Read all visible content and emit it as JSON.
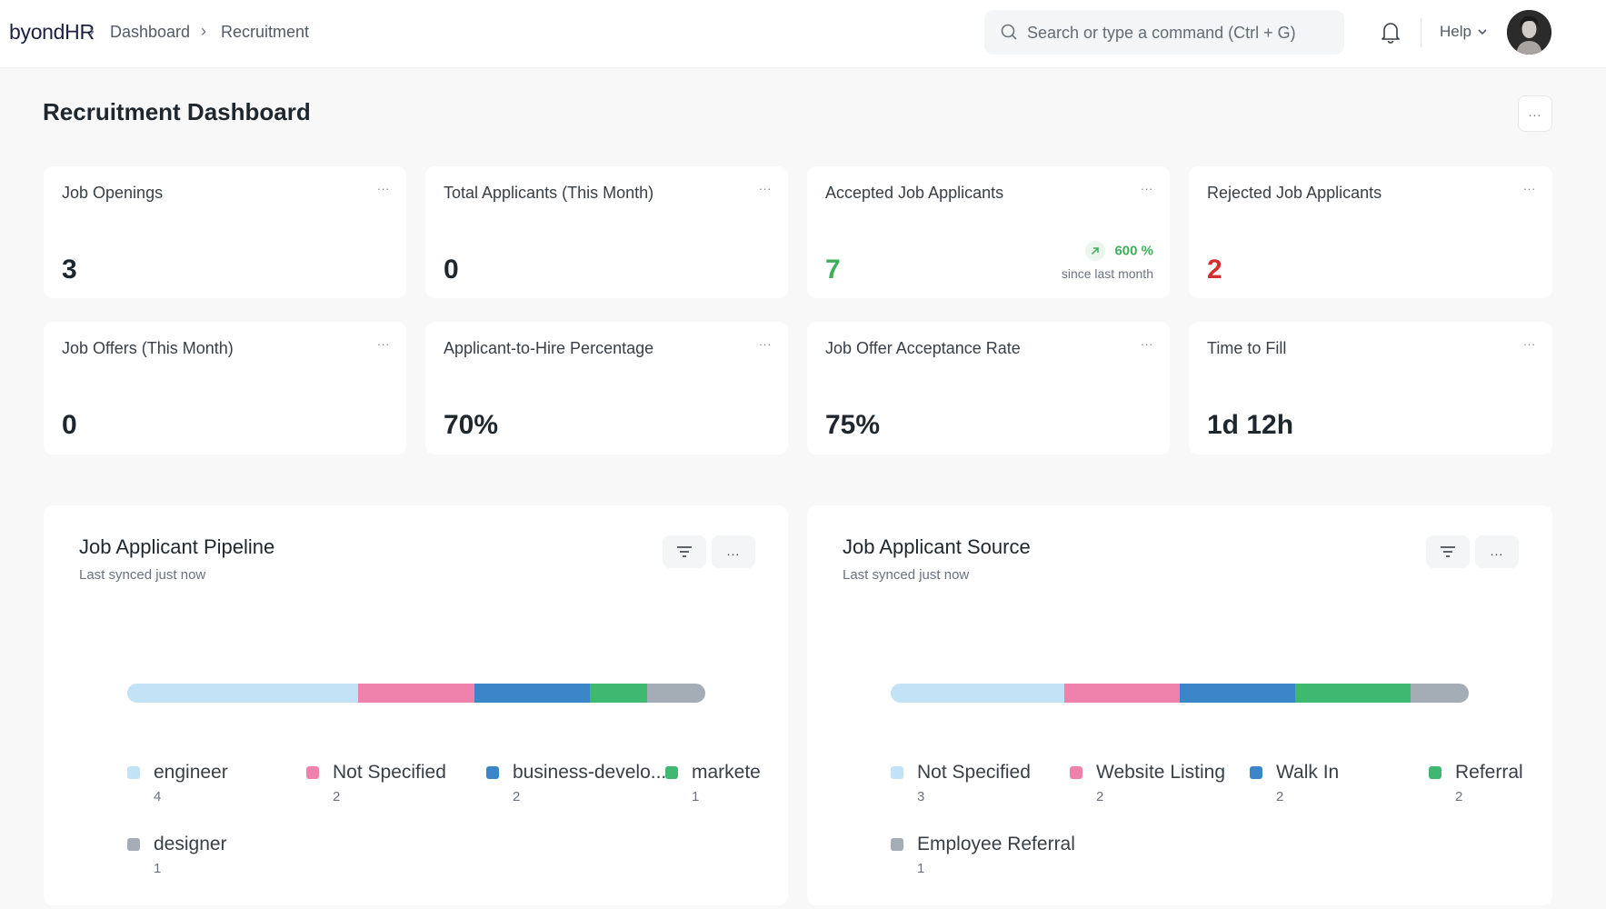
{
  "navbar": {
    "brand": "byondHR",
    "breadcrumbs": [
      "Dashboard",
      "Recruitment"
    ],
    "search_placeholder": "Search or type a command (Ctrl + G)",
    "help_label": "Help",
    "icons": {
      "search": "search-icon",
      "notifications": "bell-icon",
      "help_dropdown": "chevron-down-icon",
      "avatar": "user-avatar"
    }
  },
  "page": {
    "title": "Recruitment Dashboard",
    "menu_label": "..."
  },
  "number_cards": [
    {
      "title": "Job Openings",
      "value": "3",
      "menu": "..."
    },
    {
      "title": "Total Applicants (This Month)",
      "value": "0",
      "menu": "..."
    },
    {
      "title": "Accepted Job Applicants",
      "value": "7",
      "menu": "...",
      "value_color": "#3fae5a",
      "trend": {
        "direction": "up",
        "icon": "arrow-up-right-icon",
        "percent": "600 %",
        "label": "since last month",
        "color": "#3fae5a"
      }
    },
    {
      "title": "Rejected Job Applicants",
      "value": "2",
      "menu": "...",
      "value_color": "#d42f2f"
    },
    {
      "title": "Job Offers (This Month)",
      "value": "0",
      "menu": "..."
    },
    {
      "title": "Applicant-to-Hire Percentage",
      "value": "70%",
      "menu": "..."
    },
    {
      "title": "Job Offer Acceptance Rate",
      "value": "75%",
      "menu": "..."
    },
    {
      "title": "Time to Fill",
      "value": "1d 12h",
      "menu": "..."
    }
  ],
  "chart_data": [
    {
      "type": "bar",
      "subtype": "percentage-stacked-horizontal",
      "title": "Job Applicant Pipeline",
      "subtitle": "Last synced just now",
      "categories": [
        "engineer",
        "Not Specified",
        "business-develo...",
        "markete",
        "designer"
      ],
      "values": [
        4,
        2,
        2,
        1,
        1
      ],
      "colors": [
        "#c2e2f6",
        "#ef82ac",
        "#3a86c8",
        "#3fb872",
        "#a4adb5"
      ],
      "legend_placement": "bottom",
      "buttons": {
        "filter": "filter-icon",
        "menu": "..."
      }
    },
    {
      "type": "bar",
      "subtype": "percentage-stacked-horizontal",
      "title": "Job Applicant Source",
      "subtitle": "Last synced just now",
      "categories": [
        "Not Specified",
        "Website Listing",
        "Walk In",
        "Referral",
        "Employee Referral"
      ],
      "values": [
        3,
        2,
        2,
        2,
        1
      ],
      "colors": [
        "#c2e2f6",
        "#ef82ac",
        "#3a86c8",
        "#3fb872",
        "#a4adb5"
      ],
      "legend_placement": "bottom",
      "buttons": {
        "filter": "filter-icon",
        "menu": "..."
      }
    }
  ]
}
